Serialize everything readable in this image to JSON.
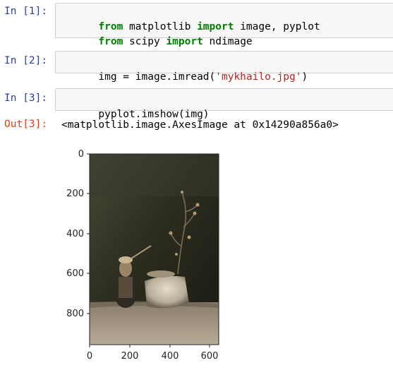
{
  "cells": [
    {
      "prompt": "In [1]:",
      "lines": [
        [
          {
            "t": "from",
            "c": "kw"
          },
          {
            "t": " matplotlib ",
            "c": "plain"
          },
          {
            "t": "import",
            "c": "kw"
          },
          {
            "t": " image, pyplot",
            "c": "plain"
          }
        ],
        [
          {
            "t": "from",
            "c": "kw"
          },
          {
            "t": " scipy ",
            "c": "plain"
          },
          {
            "t": "import",
            "c": "kw"
          },
          {
            "t": " ndimage",
            "c": "plain"
          }
        ]
      ]
    },
    {
      "prompt": "In [2]:",
      "lines": [
        [
          {
            "t": "img = image.imread(",
            "c": "plain"
          },
          {
            "t": "'mykhailo.jpg'",
            "c": "str"
          },
          {
            "t": ")",
            "c": "plain"
          }
        ]
      ]
    },
    {
      "prompt": "In [3]:",
      "lines": [
        [
          {
            "t": "pyplot.imshow(img)",
            "c": "plain"
          }
        ]
      ]
    }
  ],
  "output": {
    "prompt": "Out[3]:",
    "text": "<matplotlib.image.AxesImage at 0x14290a856a0>"
  },
  "plot": {
    "y_ticks": [
      "0",
      "200",
      "400",
      "600",
      "800"
    ],
    "x_ticks": [
      "0",
      "200",
      "400",
      "600"
    ],
    "image_desc": "still-life photo: figurine and vase with branch on dark background"
  }
}
